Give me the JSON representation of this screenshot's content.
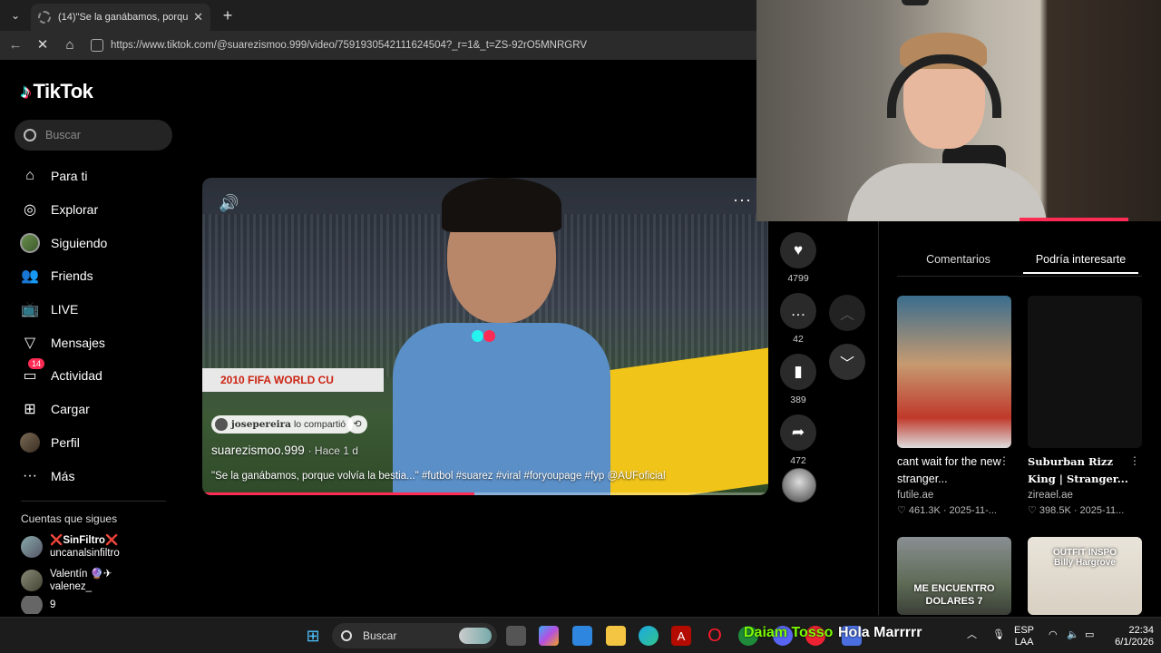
{
  "browser": {
    "tab_title": "(14)\"Se la ganábamos, porque volv",
    "tab_close": "✕",
    "new_tab": "+",
    "url": "https://www.tiktok.com/@suarezismoo.999/video/7591930542111624504?_r=1&_t=ZS-92rO5MNRGRV"
  },
  "tiktok": {
    "logo": "TikTok",
    "search_placeholder": "Buscar",
    "nav": [
      {
        "label": "Para ti",
        "icon": "home-icon"
      },
      {
        "label": "Explorar",
        "icon": "compass-icon"
      },
      {
        "label": "Siguiendo",
        "icon": "following-avatar"
      },
      {
        "label": "Friends",
        "icon": "friends-icon"
      },
      {
        "label": "LIVE",
        "icon": "live-icon"
      },
      {
        "label": "Mensajes",
        "icon": "messages-icon"
      },
      {
        "label": "Actividad",
        "icon": "activity-icon",
        "badge": "14"
      },
      {
        "label": "Cargar",
        "icon": "upload-icon"
      },
      {
        "label": "Perfil",
        "icon": "profile-avatar"
      },
      {
        "label": "Más",
        "icon": "more-icon"
      }
    ],
    "following_header": "Cuentas que sigues",
    "following": [
      {
        "name": "❌SinFiltro❌",
        "handle": "uncanalsinfiltro"
      },
      {
        "name": "Valentín 🔮✈",
        "handle": "valenez_"
      },
      {
        "name": "9",
        "handle": ""
      }
    ]
  },
  "video": {
    "banner_text": "2010 FIFA WORLD CU",
    "repost_user": "josepereira",
    "repost_text": "lo compartió",
    "author": "suarezismoo.999",
    "ago": "· Hace 1 d",
    "description": "\"Se la ganábamos, porque volvía la bestia...\" #futbol #suarez #viral #foryoupage #fyp @AUFoficial",
    "progress": 0.48,
    "likes": "4799",
    "comments": "42",
    "saves": "389",
    "shares": "472"
  },
  "right_panel": {
    "tabs": [
      "Comentarios",
      "Podría interesarte"
    ],
    "active_tab": 1,
    "cards": [
      {
        "title": "cant wait for the new stranger...",
        "author": "futile.ae",
        "stats": "♡ 461.3K · 2025-11-...",
        "serif": false
      },
      {
        "title": "Suburban Rizz King | Stranger...",
        "author": "zireael.ae",
        "stats": "♡ 398.5K · 2025-11...",
        "serif": true
      },
      {
        "title": "",
        "author": "",
        "stats": "",
        "thumb_text": "ME ENCUENTRO DOLARES 7"
      },
      {
        "title": "",
        "author": "",
        "stats": "",
        "thumb_text": "OUTFIT INSPO Billy Hargrove"
      }
    ]
  },
  "taskbar": {
    "search": "Buscar",
    "overlay_left": "Daiam Tosso",
    "overlay_right": "Hola Marrrrr",
    "lang": "ESP",
    "region": "LAA",
    "time": "22:34",
    "date": "6/1/2026"
  },
  "colors": {
    "accent": "#fe2c55",
    "cyan": "#25f4ee",
    "bg": "#000000"
  }
}
